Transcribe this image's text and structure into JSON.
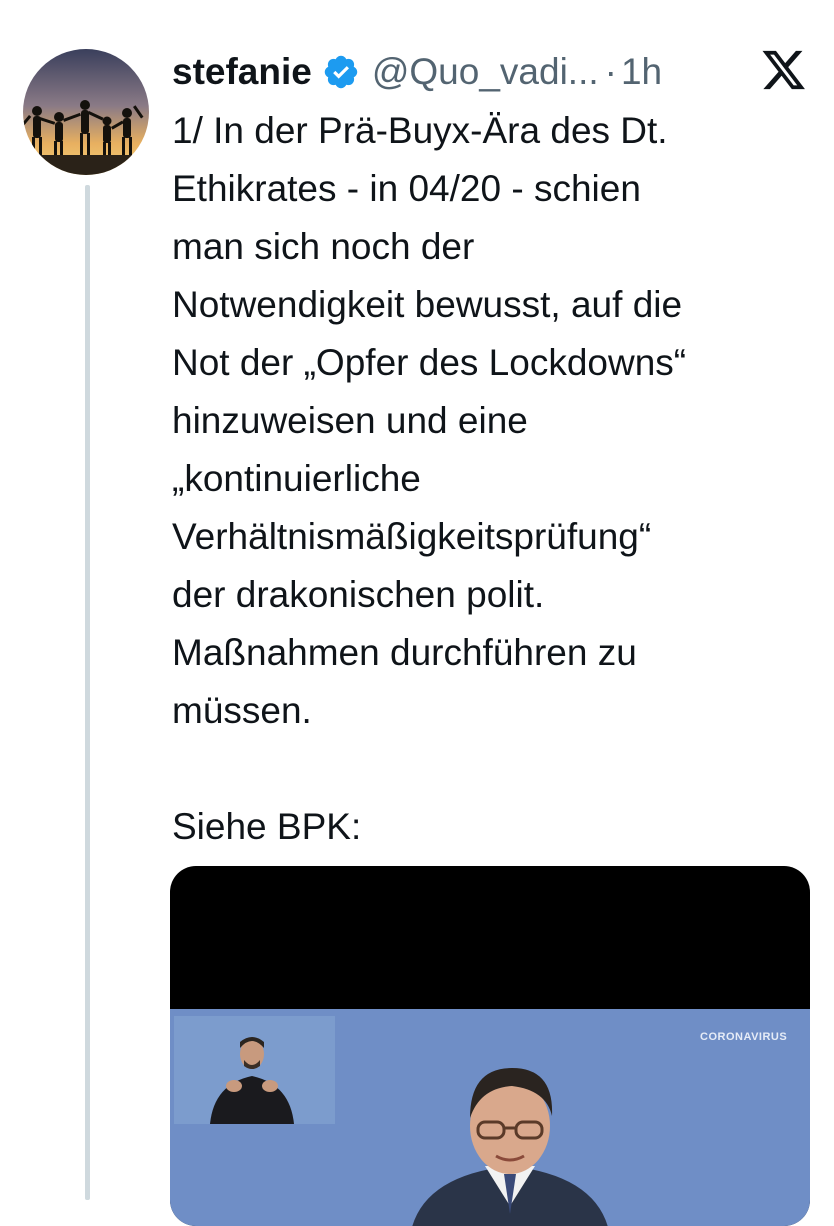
{
  "tweet": {
    "author": {
      "display_name": "stefanie",
      "handle": "@Quo_vadi...",
      "verified": true,
      "avatar_icon": "silhouettes-sunset-avatar"
    },
    "separator": "·",
    "timestamp": "1h",
    "platform_icon": "x-logo-icon",
    "text_lines": [
      "1/ In der Prä-Buyx-Ära des Dt.",
      "Ethikrates - in 04/20 - schien",
      "man sich noch der",
      "Notwendigkeit bewusst, auf die",
      "Not der „Opfer des Lockdowns“",
      "hinzuweisen und eine",
      "„kontinuierliche",
      "Verhältnismäßigkeitsprüfung“",
      "der drakonischen polit.",
      "Maßnahmen durchführen zu",
      "müssen."
    ],
    "text_after_break": "Siehe BPK:",
    "media": {
      "type": "video-thumbnail",
      "overlay_label": "CORONAVIRUS"
    }
  },
  "colors": {
    "text_primary": "#0f1419",
    "text_secondary": "#536471",
    "verified_blue": "#1d9bf0",
    "thread_line": "#cfd9de",
    "video_background": "#6f8ec6"
  }
}
